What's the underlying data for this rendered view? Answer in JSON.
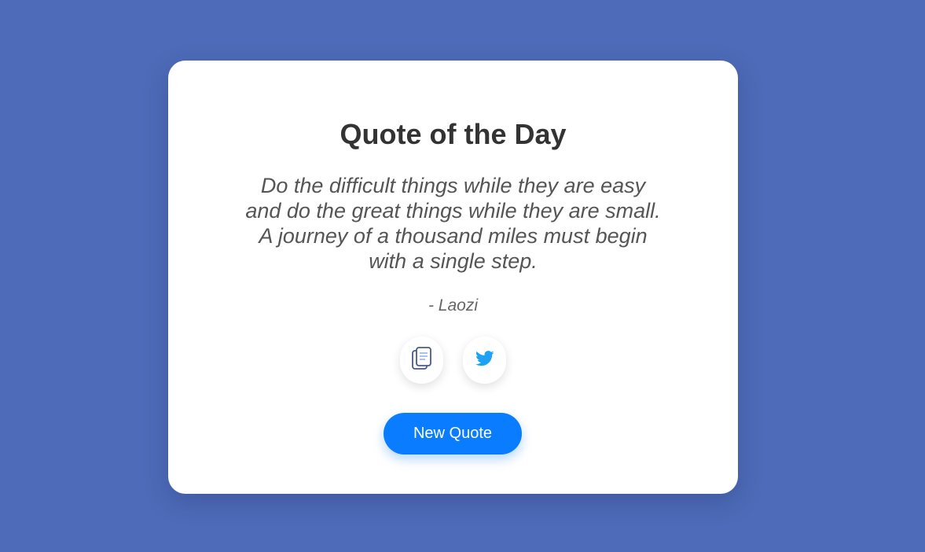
{
  "card": {
    "title": "Quote of the Day",
    "quote_text": "Do the difficult things while they are easy and do the great things while they are small. A journey of a thousand miles must begin with a single step.",
    "author": "- Laozi"
  },
  "actions": {
    "copy_icon": "copy-icon",
    "twitter_icon": "twitter-icon",
    "new_quote_label": "New Quote"
  },
  "colors": {
    "background": "#4d6bb8",
    "card": "#ffffff",
    "accent": "#0a7cff",
    "twitter": "#1da1f2"
  }
}
